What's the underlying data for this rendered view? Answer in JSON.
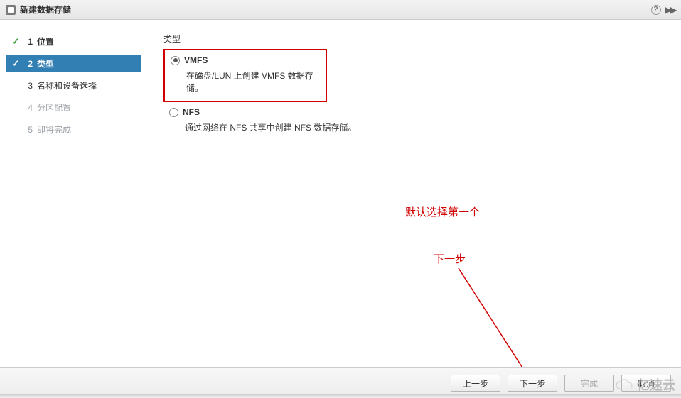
{
  "title": "新建数据存储",
  "sidebar": {
    "steps": [
      {
        "num": "1",
        "label": "位置",
        "completed": true,
        "active": false,
        "disabled": false
      },
      {
        "num": "2",
        "label": "类型",
        "completed": true,
        "active": true,
        "disabled": false
      },
      {
        "num": "3",
        "label": "名称和设备选择",
        "completed": false,
        "active": false,
        "disabled": false
      },
      {
        "num": "4",
        "label": "分区配置",
        "completed": false,
        "active": false,
        "disabled": true
      },
      {
        "num": "5",
        "label": "即将完成",
        "completed": false,
        "active": false,
        "disabled": true
      }
    ]
  },
  "content": {
    "section_label": "类型",
    "options": [
      {
        "value": "VMFS",
        "label": "VMFS",
        "desc": "在磁盘/LUN 上创建 VMFS 数据存储。",
        "checked": true
      },
      {
        "value": "NFS",
        "label": "NFS",
        "desc": "通过网络在 NFS 共享中创建 NFS 数据存储。",
        "checked": false
      }
    ]
  },
  "annotations": {
    "default_first": "默认选择第一个",
    "next_hint": "下一步"
  },
  "footer": {
    "back": "上一步",
    "next": "下一步",
    "finish": "完成",
    "cancel": "取消"
  },
  "watermark": "亿速云"
}
